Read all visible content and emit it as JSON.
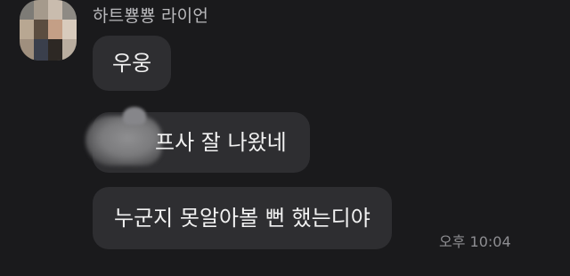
{
  "chat": {
    "sender_name": "하트뿅뿅 라이언",
    "avatar_icon": "pixelated-profile-avatar",
    "messages": [
      {
        "text": "우웅"
      },
      {
        "text": "프사 잘 나왔네",
        "has_redacted_prefix": true
      },
      {
        "text": "누군지 못알아볼 뻔 했는디야"
      }
    ],
    "timestamp": "오후 10:04"
  },
  "colors": {
    "background": "#1a1a1c",
    "bubble": "#2e2e31",
    "message_text": "#f2f2f2",
    "sender_text": "#b9b9bc",
    "time_text": "#8e8e92"
  }
}
